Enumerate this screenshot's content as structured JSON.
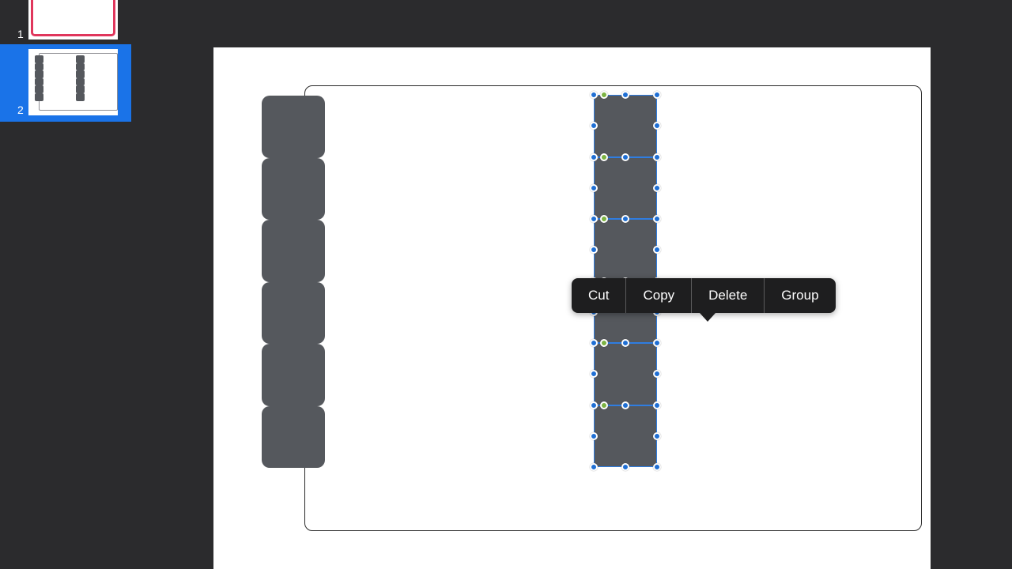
{
  "navigator": {
    "slides": [
      {
        "number": "1"
      },
      {
        "number": "2"
      }
    ]
  },
  "context_menu": {
    "items": [
      "Cut",
      "Copy",
      "Delete",
      "Group"
    ]
  },
  "colors": {
    "selection_accent": "#1a73e8",
    "shape_fill": "#55585d",
    "handle_blue": "#1f6fd4",
    "handle_green": "#7cb342",
    "thumbnail_border": "#e0365c"
  }
}
